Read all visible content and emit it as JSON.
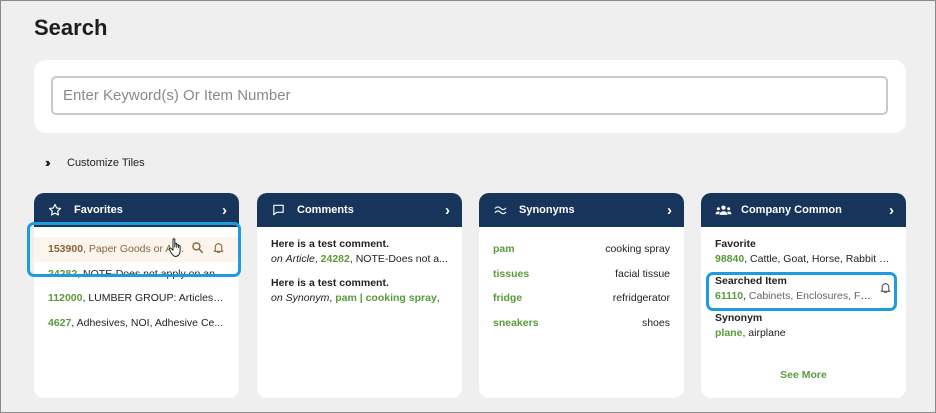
{
  "page": {
    "title": "Search"
  },
  "search": {
    "placeholder": "Enter Keyword(s) Or Item Number"
  },
  "customize": {
    "label": "Customize Tiles"
  },
  "tiles": {
    "favorites": {
      "title": "Favorites",
      "items": [
        {
          "number": "153900",
          "text": "Paper Goods or Ar..."
        },
        {
          "number": "24282",
          "text": "NOTE-Does not apply on an..."
        },
        {
          "number": "112000",
          "text": "LUMBER GROUP: Articles c..."
        },
        {
          "number": "4627",
          "text": "Adhesives, NOI, Adhesive Ce..."
        }
      ]
    },
    "comments": {
      "title": "Comments",
      "items": [
        {
          "text": "Here is a test comment.",
          "prefix": "on",
          "type": "Article",
          "ref": "24282",
          "detail": "NOTE-Does not a..."
        },
        {
          "text": "Here is a test comment.",
          "prefix": "on",
          "type": "Synonym",
          "ref": "pam | cooking spray",
          "detail": ","
        }
      ]
    },
    "synonyms": {
      "title": "Synonyms",
      "items": [
        {
          "key": "pam",
          "value": "cooking spray"
        },
        {
          "key": "tissues",
          "value": "facial tissue"
        },
        {
          "key": "fridge",
          "value": "refridgerator"
        },
        {
          "key": "sneakers",
          "value": "shoes"
        }
      ]
    },
    "company": {
      "title": "Company Common",
      "favorite": {
        "label": "Favorite",
        "number": "98840",
        "text": "Cattle, Goat, Horse, Rabbit o..."
      },
      "searched": {
        "label": "Searched Item",
        "number": "61110",
        "text": "Cabinets, Enclosures, Fra..."
      },
      "synonym": {
        "label": "Synonym",
        "key": "plane",
        "value": "airplane"
      },
      "see_more": "See More"
    }
  },
  "colors": {
    "header": "#17345a",
    "accent": "#5a9a3a",
    "favorite_text": "#8a6538",
    "highlight": "#1e9be0"
  }
}
